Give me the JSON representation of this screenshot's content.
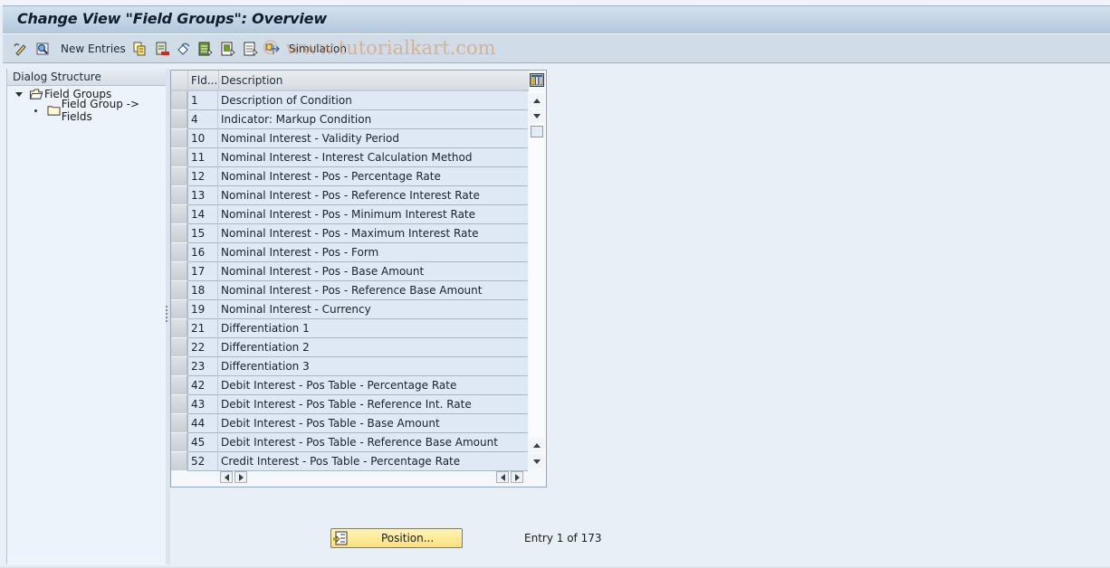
{
  "window": {
    "title": "Change View \"Field Groups\": Overview"
  },
  "toolbar": {
    "items": [
      {
        "icon": "display-change-icon",
        "label": ""
      },
      {
        "icon": "find-icon",
        "label": ""
      },
      {
        "icon": "",
        "label": "New Entries"
      },
      {
        "icon": "copy-as-icon",
        "label": ""
      },
      {
        "icon": "delete-icon",
        "label": ""
      },
      {
        "icon": "undo-change-icon",
        "label": ""
      },
      {
        "icon": "select-all-icon",
        "label": ""
      },
      {
        "icon": "select-block-icon",
        "label": ""
      },
      {
        "icon": "deselect-all-icon",
        "label": ""
      },
      {
        "icon": "transport-icon",
        "label": ""
      },
      {
        "icon": "",
        "label": "Simulation"
      }
    ],
    "new_entries_label": "New Entries",
    "simulation_label": "Simulation",
    "watermark": "© www.tutorialkart.com"
  },
  "dialog_structure": {
    "header": "Dialog Structure",
    "nodes": [
      {
        "label": "Field Groups",
        "level": 0,
        "expanded": true,
        "selected": true
      },
      {
        "label": "Field Group -> Fields",
        "level": 1,
        "expanded": false,
        "selected": false
      }
    ]
  },
  "table": {
    "columns": [
      "Fld...",
      "Description"
    ],
    "rows": [
      {
        "fld": "1",
        "description": "Description of Condition"
      },
      {
        "fld": "4",
        "description": "Indicator: Markup Condition"
      },
      {
        "fld": "10",
        "description": "Nominal Interest - Validity Period"
      },
      {
        "fld": "11",
        "description": "Nominal Interest - Interest Calculation Method"
      },
      {
        "fld": "12",
        "description": "Nominal Interest - Pos - Percentage Rate"
      },
      {
        "fld": "13",
        "description": "Nominal Interest - Pos - Reference Interest Rate"
      },
      {
        "fld": "14",
        "description": "Nominal Interest - Pos - Minimum Interest Rate"
      },
      {
        "fld": "15",
        "description": "Nominal Interest - Pos - Maximum Interest Rate"
      },
      {
        "fld": "16",
        "description": "Nominal Interest - Pos - Form"
      },
      {
        "fld": "17",
        "description": "Nominal Interest - Pos - Base Amount"
      },
      {
        "fld": "18",
        "description": "Nominal Interest - Pos - Reference Base Amount"
      },
      {
        "fld": "19",
        "description": "Nominal Interest - Currency"
      },
      {
        "fld": "21",
        "description": "Differentiation 1"
      },
      {
        "fld": "22",
        "description": "Differentiation 2"
      },
      {
        "fld": "23",
        "description": "Differentiation 3"
      },
      {
        "fld": "42",
        "description": "Debit Interest - Pos Table - Percentage Rate"
      },
      {
        "fld": "43",
        "description": "Debit Interest - Pos Table - Reference Int. Rate"
      },
      {
        "fld": "44",
        "description": "Debit Interest - Pos Table - Base Amount"
      },
      {
        "fld": "45",
        "description": "Debit Interest - Pos Table - Reference Base Amount"
      },
      {
        "fld": "52",
        "description": "Credit Interest - Pos Table - Percentage Rate"
      }
    ]
  },
  "footer": {
    "position_button": "Position...",
    "entry_info": "Entry 1 of 173"
  },
  "colors": {
    "selected_node_bg": "#fef9c4",
    "position_button_bg": "#fbe07d",
    "row_bg": "#dfe9f5"
  }
}
